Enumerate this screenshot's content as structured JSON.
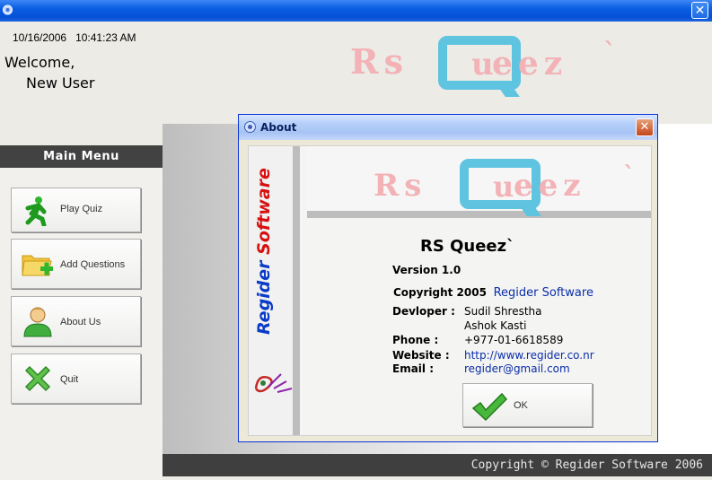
{
  "window": {
    "close_symbol": "✕"
  },
  "header": {
    "date": "10/16/2006",
    "time": "10:41:23 AM",
    "welcome": "Welcome,",
    "username": "New User"
  },
  "logo": {
    "rs": "Rs",
    "u": "u",
    "eez": "eez",
    "tick": "`"
  },
  "menu": {
    "title": "Main Menu",
    "items": [
      {
        "label": "Play Quiz",
        "icon": "running-man-icon"
      },
      {
        "label": "Add Questions",
        "icon": "folder-add-icon"
      },
      {
        "label": "About Us",
        "icon": "user-icon"
      },
      {
        "label": "Quit",
        "icon": "green-x-icon"
      }
    ]
  },
  "footer": {
    "text": "Copyright © Regider Software 2006"
  },
  "dialog": {
    "title": "About",
    "close_symbol": "✕",
    "side_brand": {
      "first": "Regider",
      "second": "Software"
    },
    "product": "RS Queez`",
    "version": "Version 1.0",
    "copyright_prefix": "Copyright 2005",
    "company": "Regider Software",
    "developer_label": "Devloper :",
    "developers": [
      "Sudil Shrestha",
      "Ashok Kasti"
    ],
    "phone_label": "Phone :",
    "phone": "+977-01-6618589",
    "website_label": "Website :",
    "website": "http://www.regider.co.nr",
    "email_label": "Email :",
    "email": "regider@gmail.com",
    "ok_label": "OK"
  },
  "colors": {
    "title_blue": "#0a5ee2",
    "logo_pink": "#f2b2b6",
    "logo_cyan": "#5fc4e0",
    "brand_blue": "#0a3bc8",
    "brand_red": "#d81010"
  }
}
